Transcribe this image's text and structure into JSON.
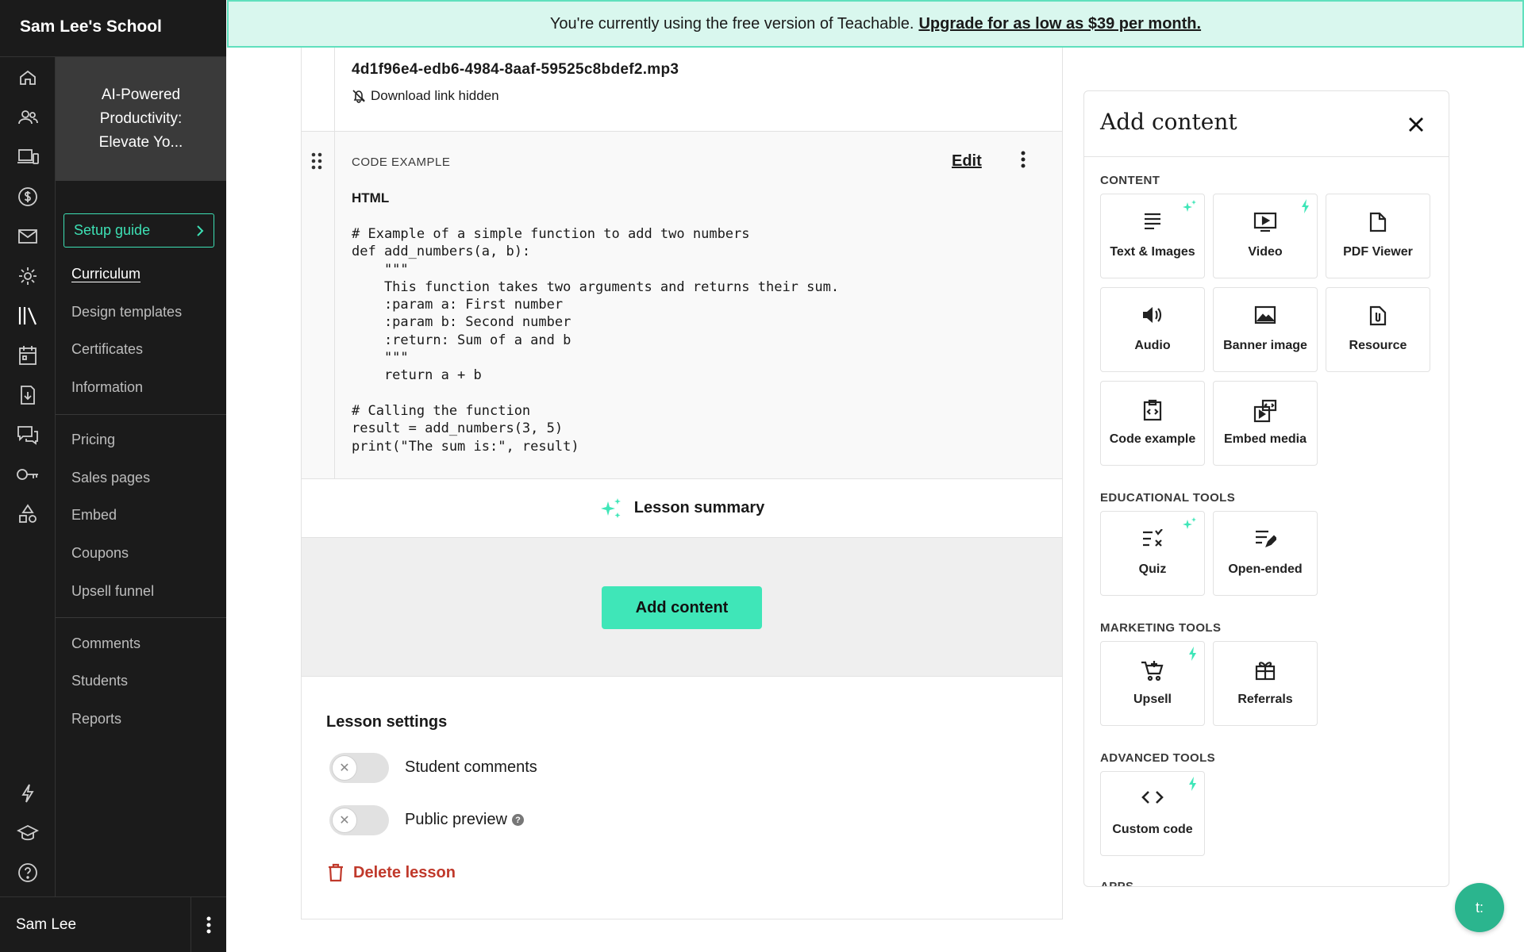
{
  "sidebar": {
    "school_name": "Sam Lee's School",
    "course_title": "AI-Powered Productivity: Elevate Yo...",
    "setup_guide": "Setup guide",
    "nav_group1": [
      "Curriculum",
      "Design templates",
      "Certificates",
      "Information"
    ],
    "nav_group2": [
      "Pricing",
      "Sales pages",
      "Embed",
      "Coupons",
      "Upsell funnel"
    ],
    "nav_group3": [
      "Comments",
      "Students",
      "Reports"
    ],
    "user_name": "Sam Lee",
    "rail_icons": [
      "home-icon",
      "users-icon",
      "devices-icon",
      "dollar-icon",
      "mail-icon",
      "gear-icon",
      "library-icon",
      "calendar-icon",
      "download-icon",
      "chat-icon",
      "key-icon",
      "shapes-icon",
      "lightning-icon",
      "graduation-cap-icon",
      "help-icon"
    ]
  },
  "banner": {
    "text": "You're currently using the free version of Teachable.",
    "link": "Upgrade for as low as $39 per month."
  },
  "lesson": {
    "file_name": "4d1f96e4-edb6-4984-8aaf-59525c8bdef2.mp3",
    "download_status": "Download link hidden",
    "code_block": {
      "tag": "CODE EXAMPLE",
      "edit_label": "Edit",
      "language": "HTML",
      "code": "# Example of a simple function to add two numbers\ndef add_numbers(a, b):\n    \"\"\"\n    This function takes two arguments and returns their sum.\n    :param a: First number\n    :param b: Second number\n    :return: Sum of a and b\n    \"\"\"\n    return a + b\n\n# Calling the function\nresult = add_numbers(3, 5)\nprint(\"The sum is:\", result)"
    },
    "summary_label": "Lesson summary",
    "add_content_label": "Add content",
    "settings": {
      "title": "Lesson settings",
      "student_comments": "Student comments",
      "public_preview": "Public preview",
      "delete_label": "Delete lesson"
    }
  },
  "panel": {
    "title": "Add content",
    "sections": {
      "content": "CONTENT",
      "educational": "EDUCATIONAL TOOLS",
      "marketing": "MARKETING TOOLS",
      "advanced": "ADVANCED TOOLS",
      "apps": "APPS"
    },
    "tiles": {
      "text_images": "Text & Images",
      "video": "Video",
      "pdf_viewer": "PDF Viewer",
      "audio": "Audio",
      "banner_image": "Banner image",
      "resource": "Resource",
      "code_example": "Code example",
      "embed_media": "Embed media",
      "quiz": "Quiz",
      "open_ended": "Open-ended",
      "upsell": "Upsell",
      "referrals": "Referrals",
      "custom_code": "Custom code"
    }
  },
  "fab_label": "t:",
  "colors": {
    "accent": "#3fe6b8",
    "sidebar_bg": "#1b1b1b",
    "danger": "#c0392b",
    "banner_bg": "#d9f7ee"
  }
}
